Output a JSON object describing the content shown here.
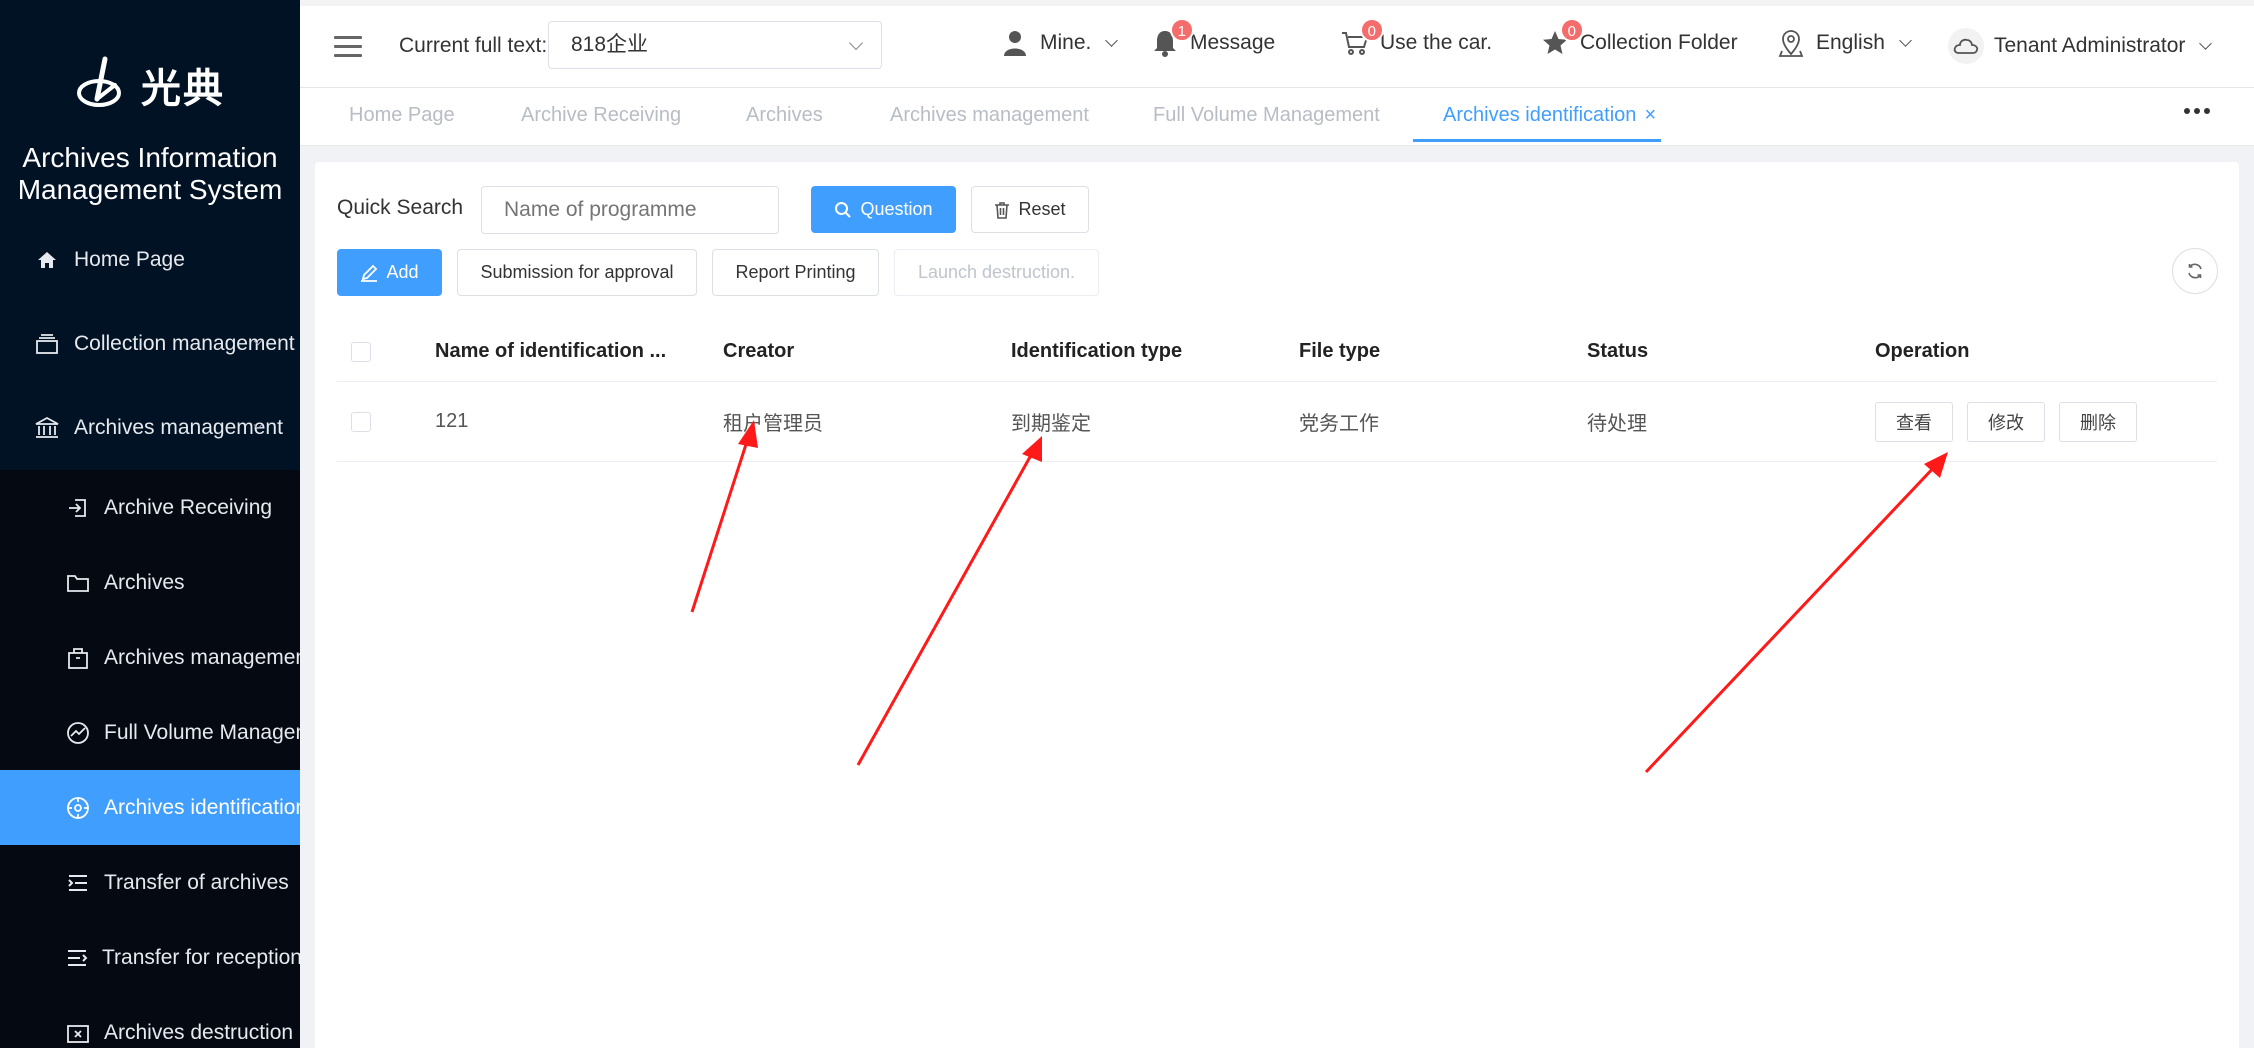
{
  "app": {
    "logo_text": "光典",
    "system_title_line1": "Archives Information",
    "system_title_line2": "Management System"
  },
  "sidebar": {
    "items": [
      {
        "label": "Home Page",
        "icon": "home-icon"
      },
      {
        "label": "Collection management",
        "icon": "layers-icon"
      },
      {
        "label": "Archives management",
        "icon": "bank-icon"
      }
    ],
    "subitems": [
      {
        "label": "Archive Receiving",
        "icon": "receive-icon"
      },
      {
        "label": "Archives",
        "icon": "folder-icon"
      },
      {
        "label": "Archives management",
        "icon": "package-icon"
      },
      {
        "label": "Full Volume Management",
        "icon": "chart-circle-icon"
      },
      {
        "label": "Archives identification",
        "icon": "target-icon",
        "active": true
      },
      {
        "label": "Transfer of archives",
        "icon": "list-indent-icon"
      },
      {
        "label": "Transfer for reception",
        "icon": "list-icon"
      },
      {
        "label": "Archives destruction",
        "icon": "delete-box-icon"
      }
    ]
  },
  "header": {
    "current_label": "Current full text:",
    "current_value": "818企业",
    "mine": "Mine.",
    "message": "Message",
    "message_count": "1",
    "car": "Use the car.",
    "car_count": "0",
    "collection": "Collection Folder",
    "collection_count": "0",
    "language": "English",
    "user": "Tenant Administrator"
  },
  "tabs": [
    {
      "label": "Home Page"
    },
    {
      "label": "Archive Receiving"
    },
    {
      "label": "Archives"
    },
    {
      "label": "Archives management"
    },
    {
      "label": "Full Volume Management"
    },
    {
      "label": "Archives identification",
      "active": true,
      "close": "×"
    }
  ],
  "search": {
    "label": "Quick Search",
    "placeholder": "Name of programme",
    "question": "Question",
    "reset": "Reset"
  },
  "toolbar": {
    "add": "Add",
    "submit": "Submission for approval",
    "report": "Report Printing",
    "destroy": "Launch destruction."
  },
  "table": {
    "columns": [
      "Name of identification ...",
      "Creator",
      "Identification type",
      "File type",
      "Status",
      "Operation"
    ],
    "rows": [
      {
        "name": "121",
        "creator": "租户管理员",
        "type": "到期鉴定",
        "file_type": "党务工作",
        "status": "待处理",
        "ops": {
          "view": "查看",
          "edit": "修改",
          "delete": "删除"
        }
      }
    ]
  },
  "colors": {
    "accent": "#409eff",
    "sidebar_bg": "#001224",
    "badge": "#f56c6c",
    "annotation": "#ff1a1a"
  }
}
